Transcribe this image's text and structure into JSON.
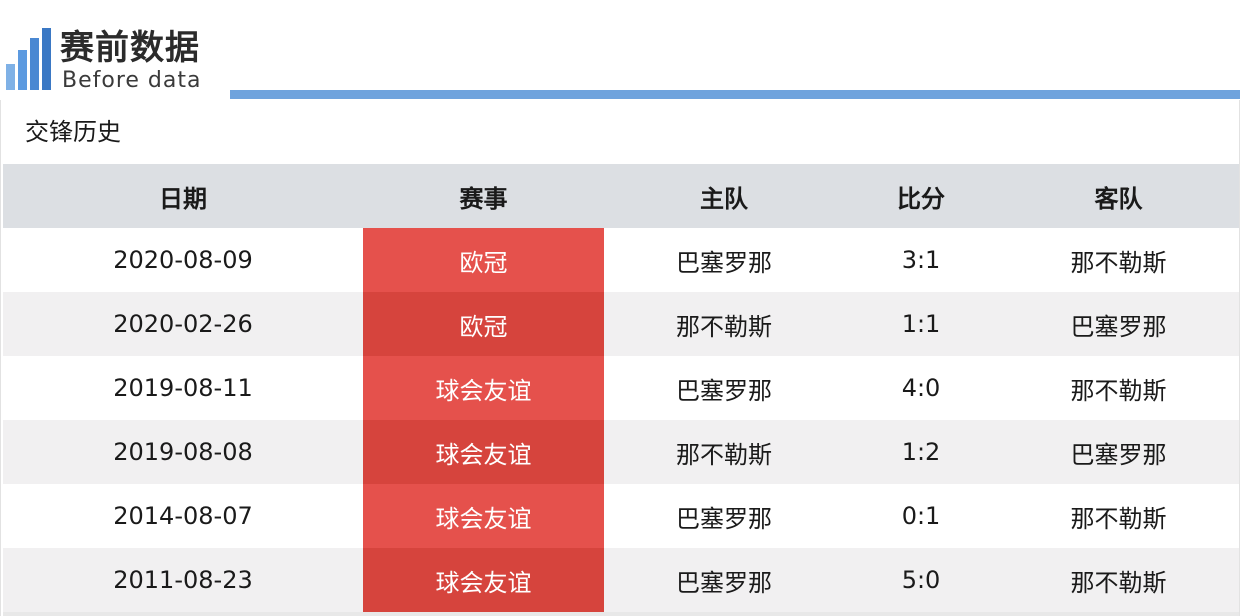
{
  "logo": {
    "title_cn": "赛前数据",
    "title_en": "Before data",
    "bar_color": "#4f8ed6"
  },
  "section": {
    "title": "交锋历史"
  },
  "table": {
    "headers": [
      "日期",
      "赛事",
      "主队",
      "比分",
      "客队"
    ],
    "rows": [
      {
        "date": "2020-08-09",
        "competition": "欧冠",
        "home": "巴塞罗那",
        "score": "3:1",
        "away": "那不勒斯"
      },
      {
        "date": "2020-02-26",
        "competition": "欧冠",
        "home": "那不勒斯",
        "score": "1:1",
        "away": "巴塞罗那"
      },
      {
        "date": "2019-08-11",
        "competition": "球会友谊",
        "home": "巴塞罗那",
        "score": "4:0",
        "away": "那不勒斯"
      },
      {
        "date": "2019-08-08",
        "competition": "球会友谊",
        "home": "那不勒斯",
        "score": "1:2",
        "away": "巴塞罗那"
      },
      {
        "date": "2014-08-07",
        "competition": "球会友谊",
        "home": "巴塞罗那",
        "score": "0:1",
        "away": "那不勒斯"
      },
      {
        "date": "2011-08-23",
        "competition": "球会友谊",
        "home": "巴塞罗那",
        "score": "5:0",
        "away": "那不勒斯"
      }
    ]
  },
  "colors": {
    "header_line": "#6fa3dd",
    "competition_bg": "#e5514c",
    "competition_bg_alt": "#d6443d",
    "table_header_bg": "#dcdfe3",
    "row_alt_bg": "#f1f0f1"
  }
}
